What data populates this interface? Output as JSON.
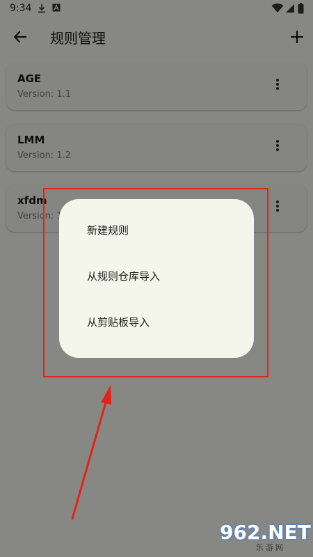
{
  "status_bar": {
    "time": "9:34",
    "left_icons": [
      "download-icon",
      "notification-a-icon"
    ],
    "right_icons": [
      "wifi-icon",
      "signal-icon",
      "battery-icon"
    ]
  },
  "app_bar": {
    "title": "规则管理",
    "back_icon": "arrow-back-icon",
    "add_icon": "plus-icon"
  },
  "rules": [
    {
      "name": "AGE",
      "version": "Version: 1.1"
    },
    {
      "name": "LMM",
      "version": "Version: 1.2"
    },
    {
      "name": "xfdm",
      "version": "Version: 1"
    }
  ],
  "menu": {
    "items": [
      {
        "label": "新建规则"
      },
      {
        "label": "从规则仓库导入"
      },
      {
        "label": "从剪贴板导入"
      }
    ]
  },
  "annotation": {
    "color": "#e2231a"
  },
  "watermark": {
    "brand": "962.NET",
    "sub": "乐游网"
  },
  "colors": {
    "background": "#f6f7f0",
    "card": "#f2f3ec",
    "menu": "#f4f6ec"
  }
}
